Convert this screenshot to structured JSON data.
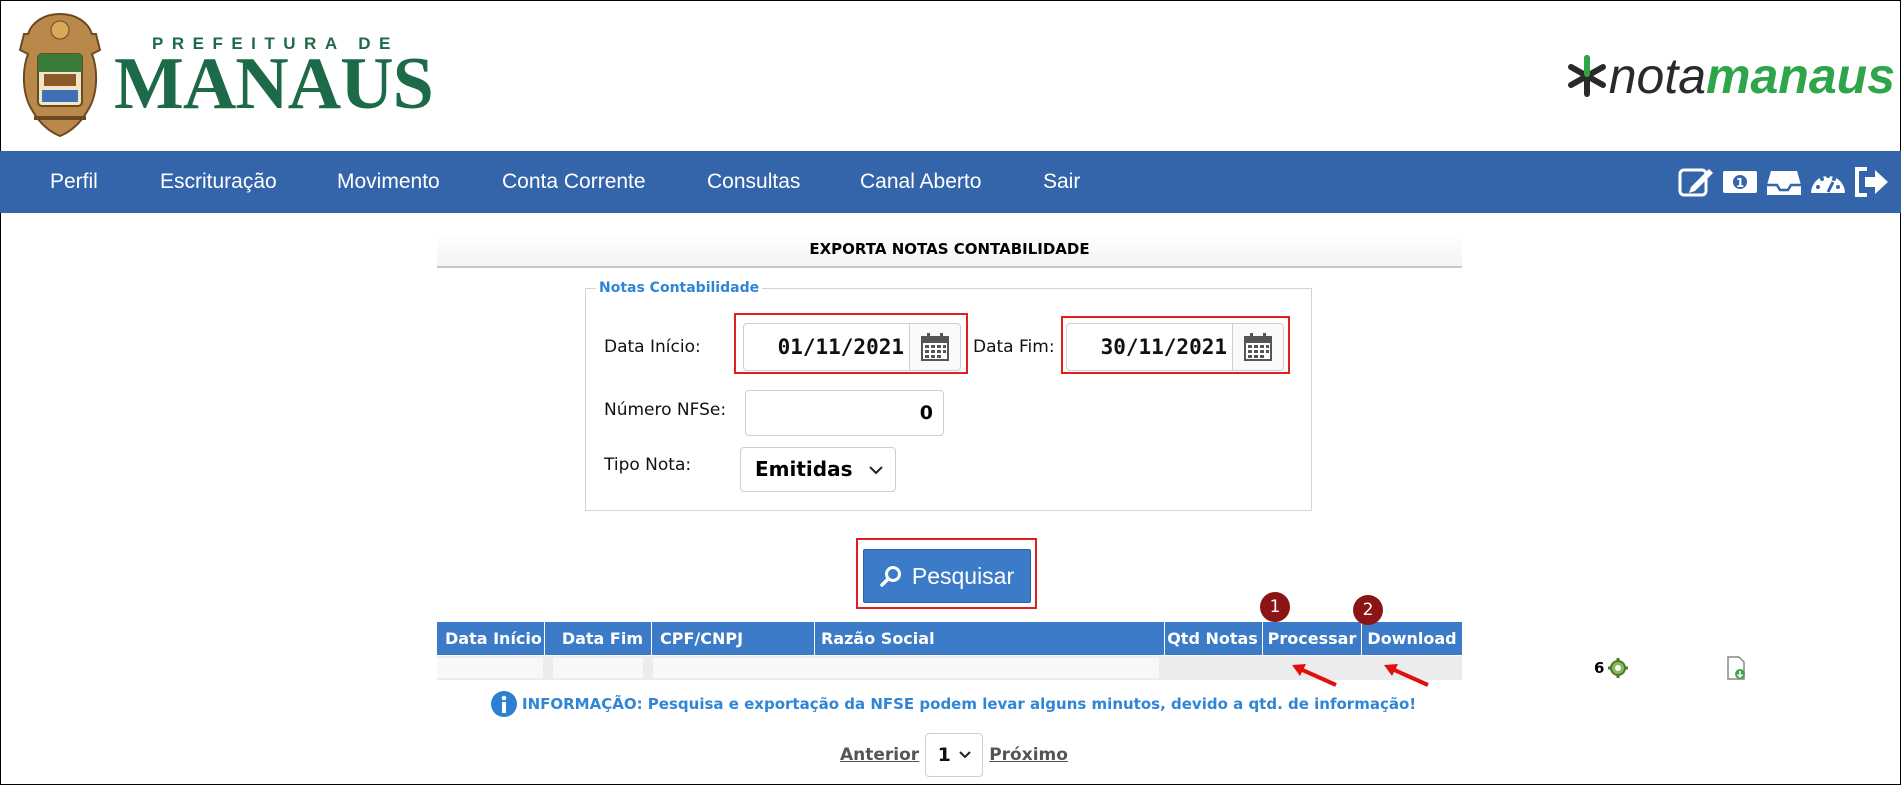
{
  "header": {
    "prefeitura_small": "PREFEITURA DE",
    "prefeitura_big": "MANAUS",
    "brand_nota": "nota",
    "brand_manaus": "manaus"
  },
  "nav": {
    "items": [
      "Perfil",
      "Escrituração",
      "Movimento",
      "Conta Corrente",
      "Consultas",
      "Canal Aberto",
      "Sair"
    ],
    "icons": [
      "edit-icon",
      "money-icon",
      "inbox-icon",
      "dashboard-icon",
      "logout-icon"
    ]
  },
  "page": {
    "title": "EXPORTA NOTAS CONTABILIDADE"
  },
  "form": {
    "legend": "Notas Contabilidade",
    "data_inicio_label": "Data Início:",
    "data_inicio_value": "01/11/2021",
    "data_fim_label": "Data Fim:",
    "data_fim_value": "30/11/2021",
    "numero_label": "Número NFSe:",
    "numero_value": "0",
    "tipo_label": "Tipo Nota:",
    "tipo_value": "Emitidas",
    "search_button": "Pesquisar"
  },
  "grid": {
    "headers": [
      "Data Início",
      "Data Fim",
      "CPF/CNPJ",
      "Razão Social",
      "Qtd Notas",
      "Processar",
      "Download"
    ],
    "row": {
      "qtd_notas": "6"
    }
  },
  "annotations": {
    "marker_1": "1",
    "marker_2": "2"
  },
  "info": {
    "text": "INFORMAÇÃO: Pesquisa e exportação da NFSE podem levar alguns minutos, devido a qtd. de informação!"
  },
  "pager": {
    "prev": "Anterior",
    "page": "1",
    "next": "Próximo"
  },
  "colors": {
    "nav_bg": "#3464aa",
    "grid_header": "#3b7bc8",
    "brand_green": "#1d6a48",
    "highlight_red": "#e02020",
    "marker_red": "#8b1414",
    "info_blue": "#2f86d6"
  }
}
